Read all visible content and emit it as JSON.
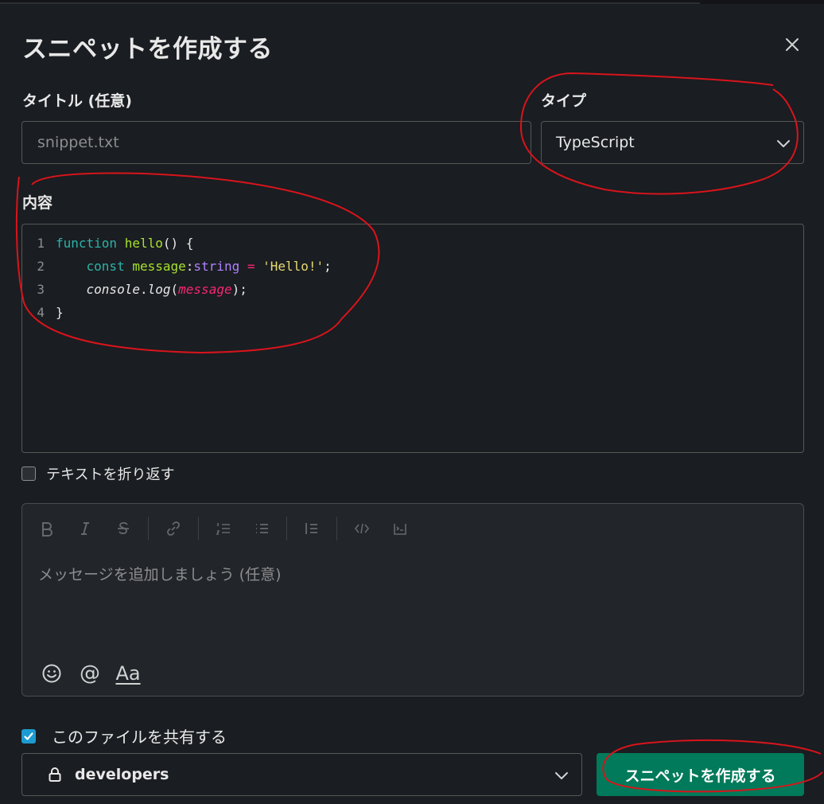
{
  "dialog": {
    "title": "スニペットを作成する",
    "close_icon": "close-icon"
  },
  "form": {
    "title_label": "タイトル (任意)",
    "title_placeholder": "snippet.txt",
    "title_value": "",
    "type_label": "タイプ",
    "type_value": "TypeScript",
    "content_label": "内容"
  },
  "code": {
    "lines": [
      {
        "num": "1",
        "tokens": [
          {
            "t": "function ",
            "c": "kw"
          },
          {
            "t": "hello",
            "c": "fn"
          },
          {
            "t": "() {",
            "c": "pl"
          }
        ]
      },
      {
        "num": "2",
        "tokens": [
          {
            "t": "    ",
            "c": "pl"
          },
          {
            "t": "const ",
            "c": "kw"
          },
          {
            "t": "message",
            "c": "fn"
          },
          {
            "t": ":",
            "c": "pl"
          },
          {
            "t": "string",
            "c": "ty"
          },
          {
            "t": " = ",
            "c": "op"
          },
          {
            "t": "'Hello!'",
            "c": "st"
          },
          {
            "t": ";",
            "c": "pl"
          }
        ]
      },
      {
        "num": "3",
        "tokens": [
          {
            "t": "    ",
            "c": "pl"
          },
          {
            "t": "console",
            "c": "it"
          },
          {
            "t": ".",
            "c": "pl"
          },
          {
            "t": "log",
            "c": "it"
          },
          {
            "t": "(",
            "c": "pl"
          },
          {
            "t": "message",
            "c": "pv"
          },
          {
            "t": ");",
            "c": "pl"
          }
        ]
      },
      {
        "num": "4",
        "tokens": [
          {
            "t": "}",
            "c": "br"
          }
        ]
      }
    ]
  },
  "wrap_text": {
    "label": "テキストを折り返す",
    "checked": false
  },
  "composer": {
    "placeholder": "メッセージを追加しましょう (任意)",
    "toolbar": [
      "bold-icon",
      "italic-icon",
      "strikethrough-icon",
      "link-icon",
      "ordered-list-icon",
      "bulleted-list-icon",
      "blockquote-icon",
      "code-icon",
      "code-block-icon"
    ],
    "bottom_tools": [
      "emoji-icon",
      "mention-icon",
      "formatting-icon"
    ],
    "formatting_glyph": "Aa",
    "mention_glyph": "@"
  },
  "share": {
    "label": "このファイルを共有する",
    "checked": true,
    "channel": "developers",
    "channel_icon": "lock-icon"
  },
  "actions": {
    "create_label": "スニペットを作成する"
  },
  "colors": {
    "background": "#1a1d21",
    "primary_button": "#007a5a",
    "checkbox_accent": "#1d9bd1",
    "annotation": "#d8141c"
  }
}
